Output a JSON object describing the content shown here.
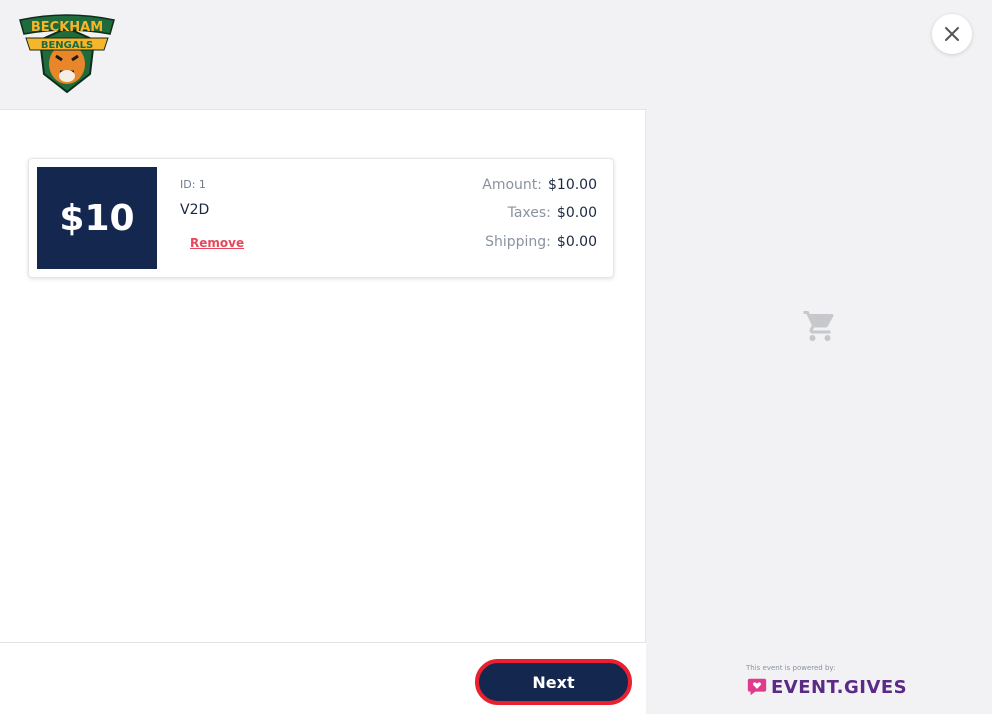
{
  "header": {
    "logo_top_text": "BECKHAM",
    "logo_bottom_text": "BENGALS"
  },
  "item": {
    "price_tile": "$10",
    "id_label": "ID: 1",
    "name": "V2D",
    "remove_label": "Remove",
    "amount_label": "Amount:",
    "amount_value": "$10.00",
    "taxes_label": "Taxes:",
    "taxes_value": "$0.00",
    "shipping_label": "Shipping:",
    "shipping_value": "$0.00"
  },
  "footer": {
    "next_label": "Next"
  },
  "sidebar": {
    "close_icon": "close-icon",
    "cart_icon": "cart-icon",
    "powered_by": "This event is powered by:",
    "brand_name": "EVENT.GIVES"
  },
  "colors": {
    "navy": "#14284f",
    "accent_red": "#e8202f",
    "remove_red": "#e5485c",
    "brand_purple": "#5b2a86"
  }
}
